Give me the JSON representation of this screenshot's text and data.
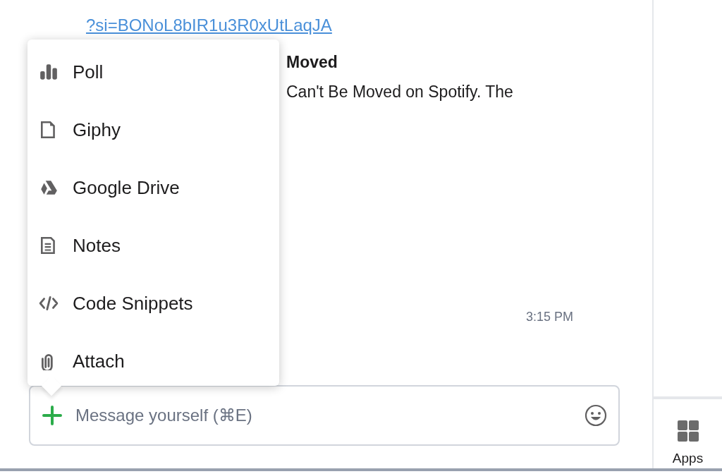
{
  "message": {
    "link_lines": [
      "?si=BONoL8bIR1u3R0xUtLaqJA"
    ],
    "preview_title": "Moved",
    "preview_text": "Can't Be Moved on Spotify. The",
    "time": "3:15 PM"
  },
  "menu": {
    "items": [
      {
        "kind": "poll",
        "label": "Poll"
      },
      {
        "kind": "giphy",
        "label": "Giphy"
      },
      {
        "kind": "drive",
        "label": "Google Drive"
      },
      {
        "kind": "notes",
        "label": "Notes"
      },
      {
        "kind": "code",
        "label": "Code Snippets"
      },
      {
        "kind": "attach",
        "label": "Attach"
      }
    ]
  },
  "composer": {
    "placeholder": "Message yourself (⌘E)"
  },
  "sidebar": {
    "apps_label": "Apps"
  }
}
